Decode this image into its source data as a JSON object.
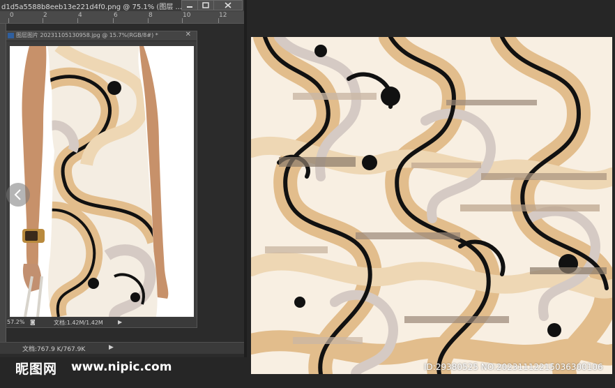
{
  "doc_tab": {
    "title": "d1d5a5588b8eeb13e221d4f0.png @ 75.1% (图层 ..."
  },
  "ruler": {
    "ticks": [
      "0",
      "2",
      "4",
      "6",
      "8",
      "10",
      "12"
    ]
  },
  "float_window": {
    "title": "图层图片 20231105130958.jpg @ 15.7%(RGB/8#) *",
    "zoom": "57.2%",
    "doc_info": "文档:1.42M/1.42M"
  },
  "main_status": {
    "doc_info": "文档:767.9 K/767.9K"
  },
  "watermark": {
    "logo": "昵图网",
    "url": "www.nipic.com",
    "id_text": "ID:29380525 NO:20231112215036300106"
  },
  "colors": {
    "cream": "#f8efe2",
    "tan": "#e2bd8c",
    "light_tan": "#eed7b4",
    "mauve": "#d5cac4",
    "black": "#111111"
  }
}
